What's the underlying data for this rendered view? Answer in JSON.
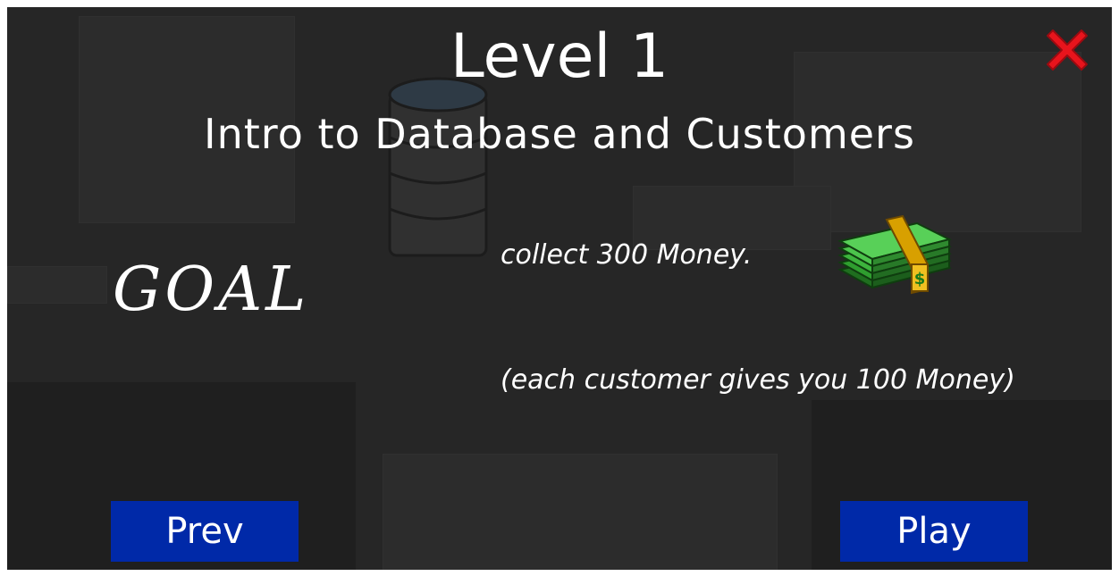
{
  "level": {
    "title": "Level 1",
    "subtitle": "Intro to Database and Customers"
  },
  "goal": {
    "heading": "GOAL",
    "objective": "collect 300 Money.",
    "note": "(each customer gives you 100 Money)"
  },
  "buttons": {
    "prev_label": "Prev",
    "play_label": "Play",
    "close_icon": "close-icon"
  },
  "colors": {
    "background": "#262626",
    "button": "#0029a8",
    "close": "#e8141c",
    "money": "#2f9e2f",
    "band": "#d8a000"
  }
}
